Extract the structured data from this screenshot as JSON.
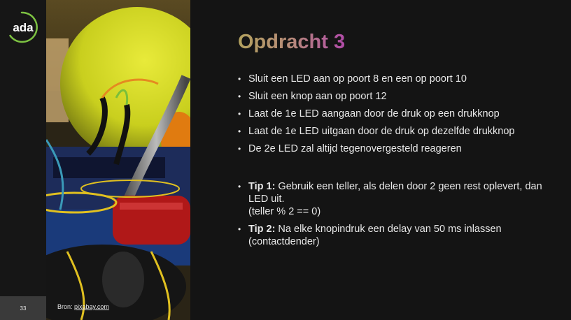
{
  "logo": {
    "text": "ada"
  },
  "page_number": "33",
  "image_credit": {
    "prefix": "Bron: ",
    "link": "pixabay.com"
  },
  "title": "Opdracht 3",
  "bullets": [
    "Sluit een LED aan op poort 8 en een op poort 10",
    "Sluit een knop aan op poort 12",
    "Laat de 1e LED aangaan door de druk op een drukknop",
    "Laat de 1e LED uitgaan door de druk op dezelfde drukknop",
    "De 2e LED zal altijd tegenovergesteld reageren"
  ],
  "tips": [
    {
      "label": "Tip 1:",
      "text": " Gebruik een teller, als delen door 2 geen rest oplevert, dan LED uit.",
      "note": "(teller % 2 == 0)"
    },
    {
      "label": "Tip 2:",
      "text": " Na elke knopindruk een delay van 50 ms inlassen (contactdender)"
    }
  ],
  "colors": {
    "background": "#141414",
    "title_gradient_start": "#b3a25e",
    "title_gradient_end": "#b14ba8",
    "logo_ring": "#7dc242"
  }
}
